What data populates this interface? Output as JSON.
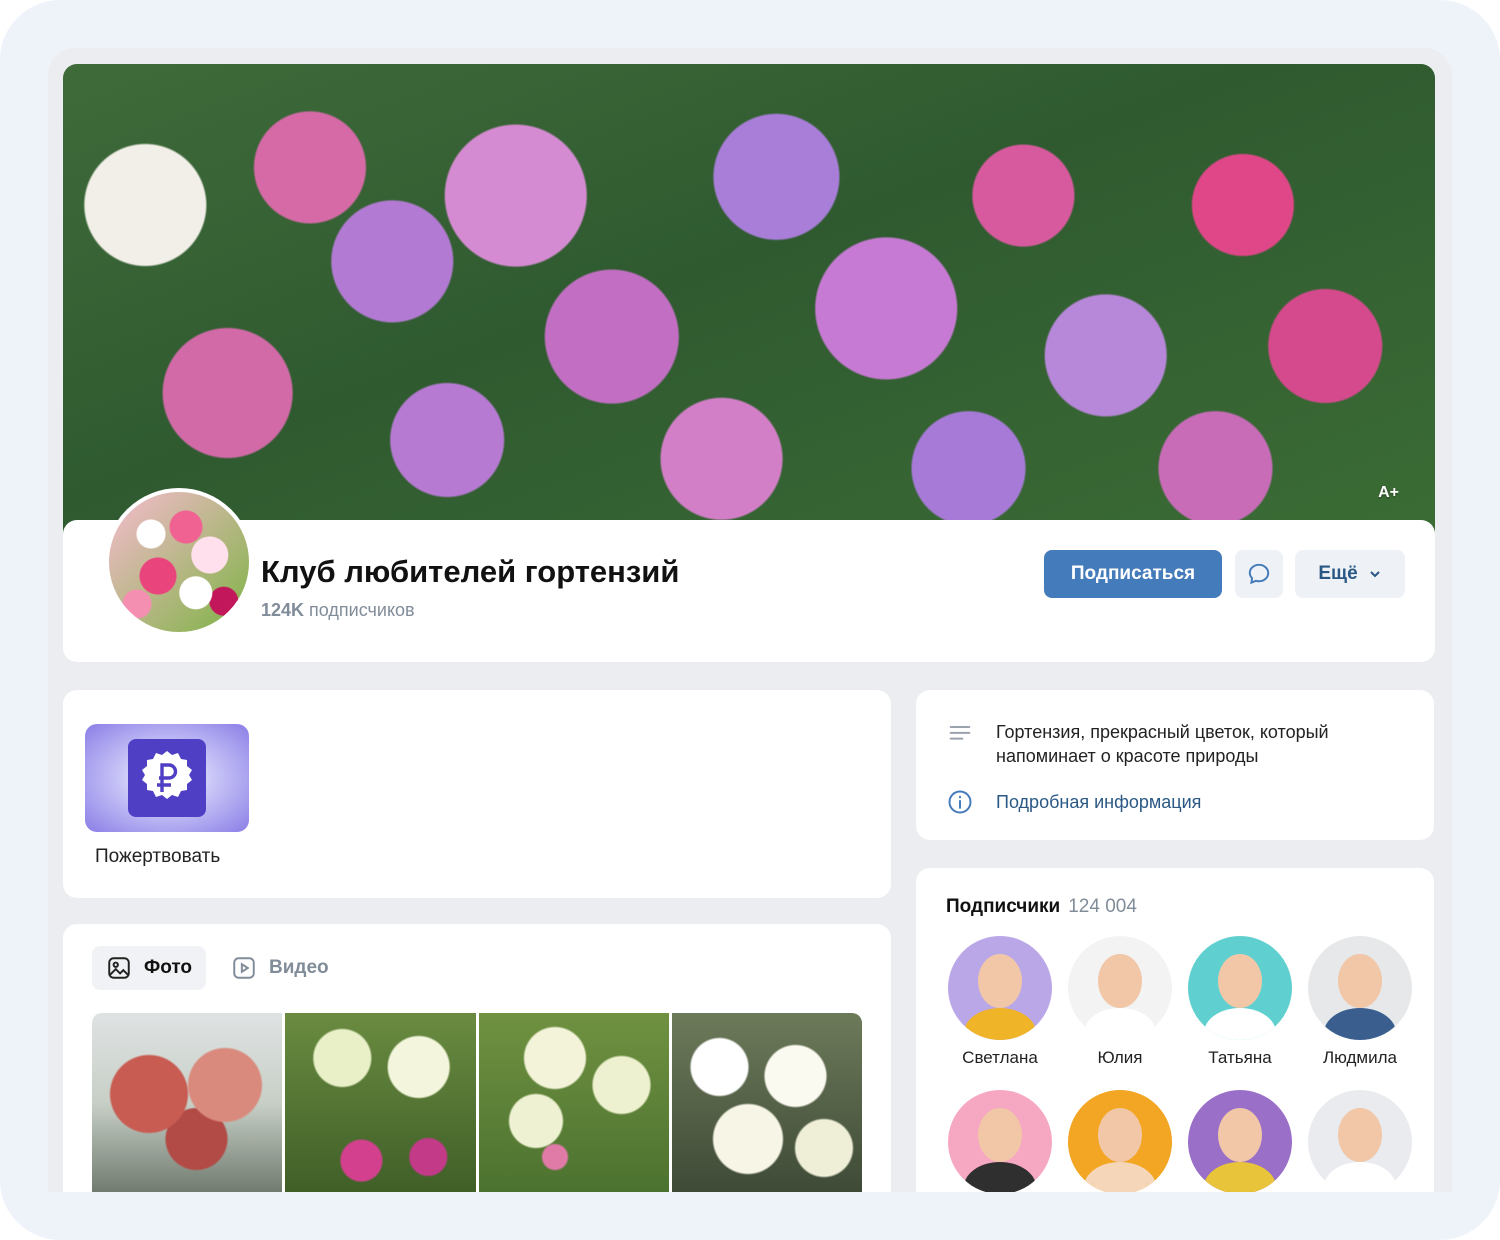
{
  "cover": {
    "badge": "A+"
  },
  "group": {
    "title": "Клуб любителей гортензий",
    "subscribers_count": "124K",
    "subscribers_label": "подписчиков"
  },
  "actions": {
    "subscribe_label": "Подписаться",
    "more_label": "Ещё"
  },
  "donate": {
    "label": "Пожертвовать"
  },
  "media": {
    "tabs": [
      {
        "label": "Фото",
        "active": true
      },
      {
        "label": "Видео",
        "active": false
      }
    ]
  },
  "about": {
    "description": "Гортензия, прекрасный цветок, который напоминает о красоте природы",
    "info_link": "Подробная информация"
  },
  "subscribers": {
    "title": "Подписчики",
    "count": "124 004",
    "people": [
      {
        "name": "Светлана",
        "bg": "#b9a7e8",
        "shirt": "#f0b429"
      },
      {
        "name": "Юлия",
        "bg": "#f3f3f3",
        "shirt": "#ffffff"
      },
      {
        "name": "Татьяна",
        "bg": "#5fd0cf",
        "shirt": "#ffffff"
      },
      {
        "name": "Людмила",
        "bg": "#e6e8ea",
        "shirt": "#3a5f8f"
      },
      {
        "name": "",
        "bg": "#f6a7c2",
        "shirt": "#2f2f2f"
      },
      {
        "name": "",
        "bg": "#f2a623",
        "shirt": "#f5d6b8"
      },
      {
        "name": "",
        "bg": "#9a6fc8",
        "shirt": "#e8c43a"
      },
      {
        "name": "",
        "bg": "#e9ebee",
        "shirt": "#ffffff"
      }
    ]
  },
  "colors": {
    "accent": "#447bba",
    "link": "#2a5885",
    "secondary_text": "#818c99",
    "donate_icon_bg": "#4f3fc4"
  }
}
